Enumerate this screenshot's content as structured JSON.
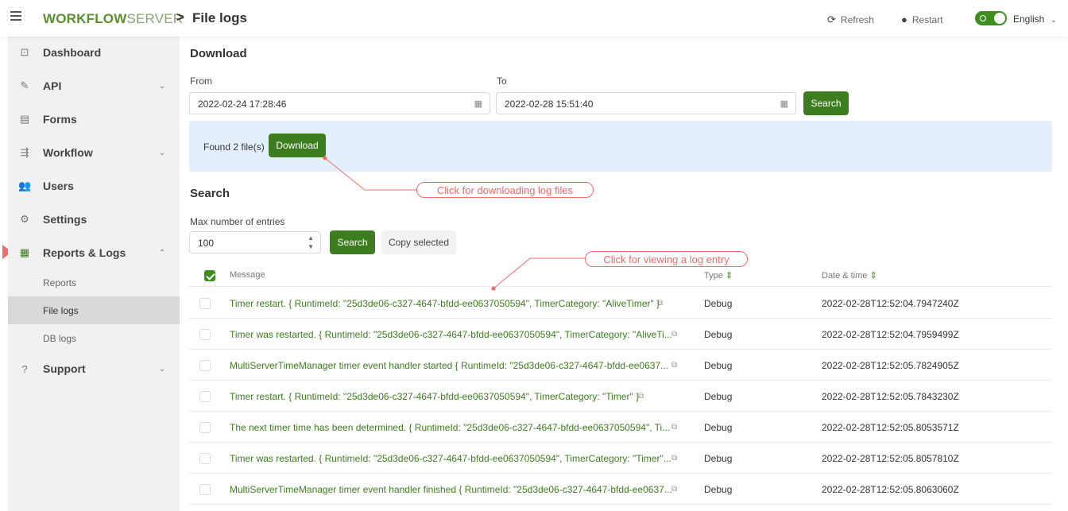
{
  "header": {
    "logo_bold": "WORKFLOW",
    "logo_light": "SERVER",
    "separator": ">",
    "title": "File logs",
    "refresh_label": "Refresh",
    "restart_label": "Restart",
    "language": "English",
    "accent_color": "#3e7d1f"
  },
  "sidebar": {
    "items": [
      {
        "label": "Dashboard",
        "icon": "dashboard-icon"
      },
      {
        "label": "API",
        "icon": "plug-icon"
      },
      {
        "label": "Forms",
        "icon": "form-icon"
      },
      {
        "label": "Workflow",
        "icon": "workflow-icon"
      },
      {
        "label": "Users",
        "icon": "users-icon"
      },
      {
        "label": "Settings",
        "icon": "gears-icon"
      },
      {
        "label": "Reports & Logs",
        "icon": "table-icon"
      },
      {
        "label": "Support",
        "icon": "help-icon"
      }
    ],
    "sub_items": [
      "Reports",
      "File logs",
      "DB logs"
    ]
  },
  "download": {
    "title": "Download",
    "from_label": "From",
    "from_value": "2022-02-24 17:28:46",
    "to_label": "To",
    "to_value": "2022-02-28 15:51:40",
    "search_label": "Search",
    "found_text": "Found 2 file(s)",
    "download_label": "Download"
  },
  "search": {
    "title": "Search",
    "max_label": "Max number of entries",
    "max_value": "100",
    "search_label": "Search",
    "copy_label": "Copy selected"
  },
  "table": {
    "col_message": "Message",
    "col_type": "Type",
    "col_date": "Date & time",
    "rows": [
      {
        "message": "Timer restart. { RuntimeId: \"25d3de06-c327-4647-bfdd-ee0637050594\", TimerCategory: \"AliveTimer\" }",
        "type": "Debug",
        "date": "2022-02-28T12:52:04.7947240Z"
      },
      {
        "message": "Timer was restarted. { RuntimeId: \"25d3de06-c327-4647-bfdd-ee0637050594\", TimerCategory: \"AliveTi...",
        "type": "Debug",
        "date": "2022-02-28T12:52:04.7959499Z"
      },
      {
        "message": "MultiServerTimeManager timer event handler started { RuntimeId: \"25d3de06-c327-4647-bfdd-ee0637...",
        "type": "Debug",
        "date": "2022-02-28T12:52:05.7824905Z"
      },
      {
        "message": "Timer restart. { RuntimeId: \"25d3de06-c327-4647-bfdd-ee0637050594\", TimerCategory: \"Timer\" }",
        "type": "Debug",
        "date": "2022-02-28T12:52:05.7843230Z"
      },
      {
        "message": "The next timer time has been determined. { RuntimeId: \"25d3de06-c327-4647-bfdd-ee0637050594\", Ti...",
        "type": "Debug",
        "date": "2022-02-28T12:52:05.8053571Z"
      },
      {
        "message": "Timer was restarted. { RuntimeId: \"25d3de06-c327-4647-bfdd-ee0637050594\", TimerCategory: \"Timer\"...",
        "type": "Debug",
        "date": "2022-02-28T12:52:05.8057810Z"
      },
      {
        "message": "MultiServerTimeManager timer event handler finished { RuntimeId: \"25d3de06-c327-4647-bfdd-ee0637...",
        "type": "Debug",
        "date": "2022-02-28T12:52:05.8063060Z"
      }
    ]
  },
  "annotations": {
    "download_hint": "Click for downloading log files",
    "entry_hint": "Click for viewing a log entry",
    "color": "#f26b6b"
  }
}
